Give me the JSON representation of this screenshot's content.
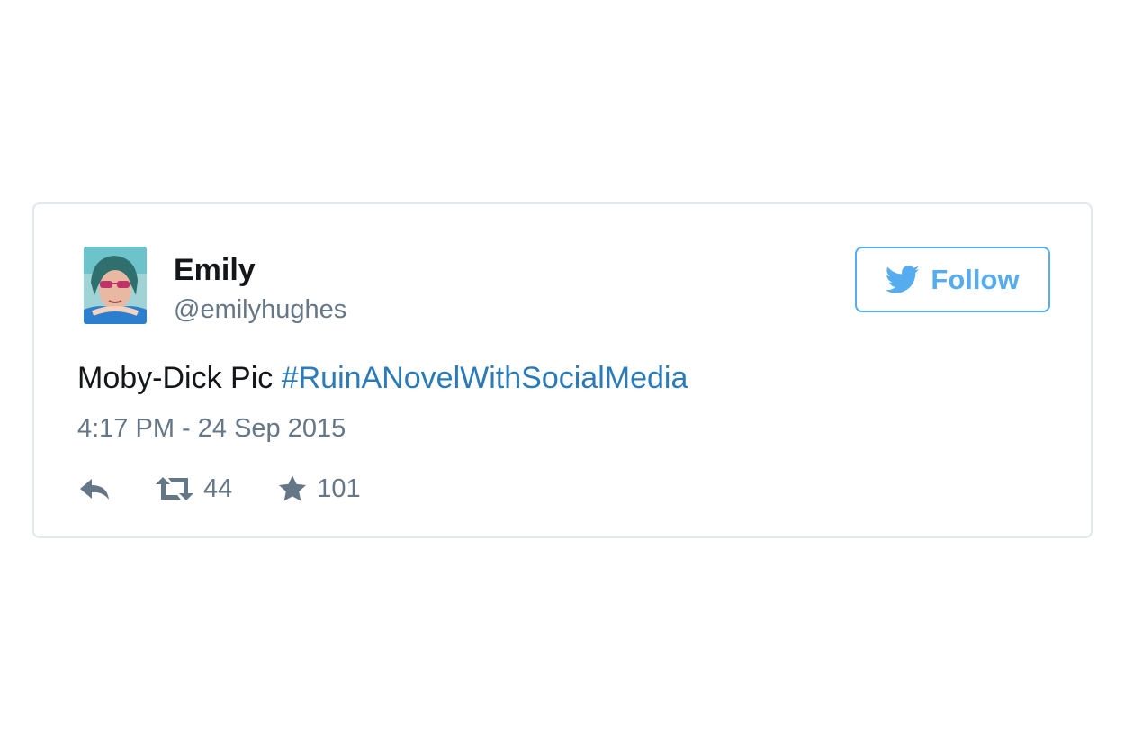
{
  "tweet": {
    "user": {
      "display_name": "Emily",
      "handle": "@emilyhughes",
      "avatar_alt": "Emily"
    },
    "follow": {
      "label": "Follow",
      "icon": "twitter-bird-icon"
    },
    "text": "Moby-Dick Pic ",
    "hashtag": "#RuinANovelWithSocialMedia",
    "timestamp": "4:17 PM - 24 Sep 2015",
    "actions": {
      "reply_icon": "reply-icon",
      "retweet_icon": "retweet-icon",
      "retweet_count": "44",
      "favorite_icon": "star-icon",
      "favorite_count": "101"
    }
  },
  "colors": {
    "accent": "#55acee",
    "link": "#2b7bb9",
    "text": "#14171a",
    "muted": "#657786",
    "border": "#e1e8ed"
  }
}
